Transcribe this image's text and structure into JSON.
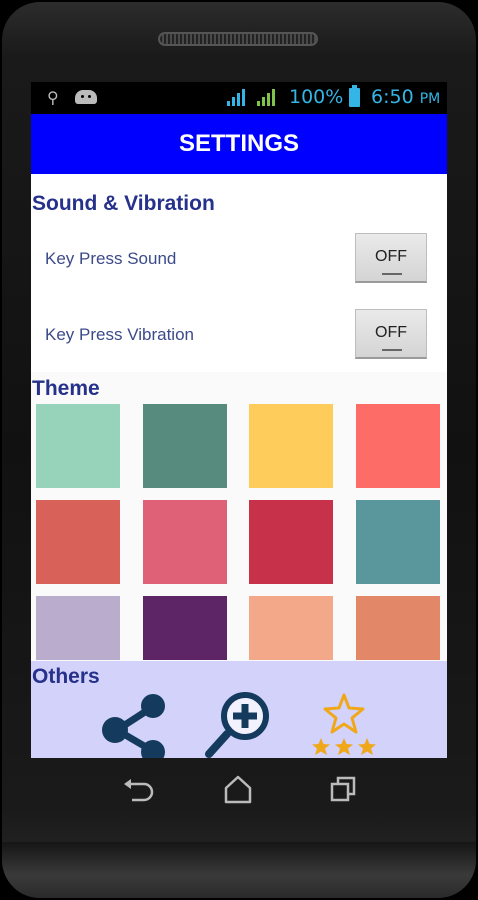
{
  "status_bar": {
    "battery_percent": "100%",
    "time": "6:50",
    "ampm": "PM",
    "accent_color": "#33b5e5"
  },
  "app_bar": {
    "title": "SETTINGS",
    "color": "#0000fe"
  },
  "sound_section": {
    "title": "Sound & Vibration",
    "rows": [
      {
        "label": "Key Press Sound",
        "toggle": "OFF"
      },
      {
        "label": "Key Press Vibration",
        "toggle": "OFF"
      }
    ]
  },
  "theme_section": {
    "title": "Theme",
    "swatches": [
      "#97d2bb",
      "#578b7d",
      "#fecc5b",
      "#fe6c67",
      "#d8615a",
      "#df6177",
      "#c7324a",
      "#5a979c",
      "#baaccd",
      "#5e2566",
      "#f4a88a",
      "#e28868"
    ]
  },
  "others_section": {
    "title": "Others",
    "icons": [
      "share-icon",
      "zoom-in-icon",
      "rate-stars-icon"
    ]
  },
  "navigation": {
    "icons": [
      "back-icon",
      "home-icon",
      "recent-apps-icon"
    ]
  }
}
